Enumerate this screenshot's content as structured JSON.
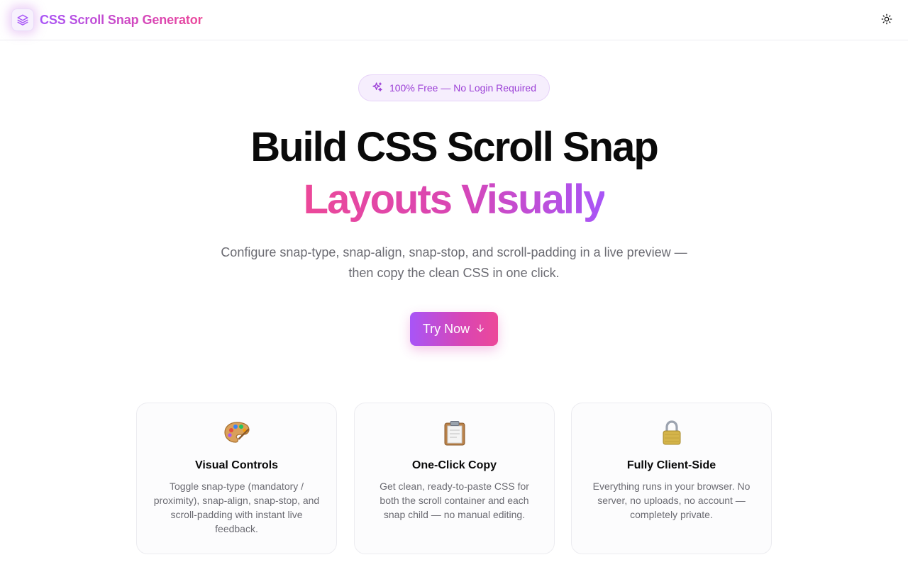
{
  "header": {
    "brand_name": "CSS Scroll Snap Generator",
    "logo_icon": "layers-icon",
    "theme_toggle_icon": "sun-icon"
  },
  "hero": {
    "badge_icon": "sparkles-icon",
    "badge_text": "100% Free — No Login Required",
    "title_line1": "Build CSS Scroll Snap",
    "title_line2": "Layouts Visually",
    "subtitle_line1": "Configure snap-type, snap-align, snap-stop, and scroll-padding in a live preview —",
    "subtitle_line2": "then copy the clean CSS in one click.",
    "cta_label": "Try Now",
    "cta_icon": "arrow-down-icon"
  },
  "features": [
    {
      "icon": "palette-icon",
      "title": "Visual Controls",
      "description": "Toggle snap-type (mandatory / proximity), snap-align, snap-stop, and scroll-padding with instant live feedback."
    },
    {
      "icon": "clipboard-icon",
      "title": "One-Click Copy",
      "description": "Get clean, ready-to-paste CSS for both the scroll container and each snap child — no manual editing."
    },
    {
      "icon": "lock-icon",
      "title": "Fully Client-Side",
      "description": "Everything runs in your browser. No server, no uploads, no account — completely private."
    }
  ],
  "colors": {
    "accent_purple": "#a855f7",
    "accent_pink": "#ec4899",
    "badge_text": "#9b3fd6",
    "muted_text": "#6b6b72"
  }
}
